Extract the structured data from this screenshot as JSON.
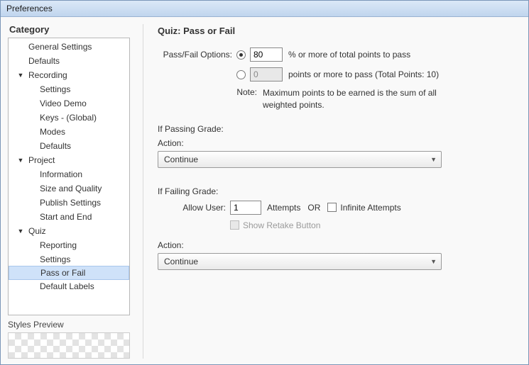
{
  "window": {
    "title": "Preferences"
  },
  "sidebar": {
    "header": "Category",
    "items": [
      {
        "label": "General Settings",
        "level": "level0"
      },
      {
        "label": "Defaults",
        "level": "level0"
      },
      {
        "label": "Recording",
        "level": "has-arrow",
        "arrow": "▼"
      },
      {
        "label": "Settings",
        "level": "level1"
      },
      {
        "label": "Video Demo",
        "level": "level1"
      },
      {
        "label": "Keys - (Global)",
        "level": "level1"
      },
      {
        "label": "Modes",
        "level": "level1"
      },
      {
        "label": "Defaults",
        "level": "level1"
      },
      {
        "label": "Project",
        "level": "has-arrow",
        "arrow": "▼"
      },
      {
        "label": "Information",
        "level": "level1"
      },
      {
        "label": "Size and Quality",
        "level": "level1"
      },
      {
        "label": "Publish Settings",
        "level": "level1"
      },
      {
        "label": "Start and End",
        "level": "level1"
      },
      {
        "label": "Quiz",
        "level": "has-arrow",
        "arrow": "▼"
      },
      {
        "label": "Reporting",
        "level": "level1"
      },
      {
        "label": "Settings",
        "level": "level1"
      },
      {
        "label": "Pass or Fail",
        "level": "level1",
        "selected": true
      },
      {
        "label": "Default Labels",
        "level": "level1"
      }
    ],
    "styles_preview": "Styles Preview"
  },
  "panel": {
    "title": "Quiz: Pass or Fail",
    "pf_options_label": "Pass/Fail Options:",
    "percent_value": "80",
    "percent_suffix": "% or more of total points to pass",
    "points_value": "0",
    "points_suffix": "points or more to pass (Total Points: 10)",
    "note_label": "Note:",
    "note_text": "Maximum points to be earned is the sum of all weighted points.",
    "passing_header": "If Passing Grade:",
    "action_label": "Action:",
    "passing_action": "Continue",
    "failing_header": "If Failing Grade:",
    "allow_user_label": "Allow User:",
    "attempts_value": "1",
    "attempts_suffix": "Attempts",
    "or_text": "OR",
    "infinite_label": "Infinite Attempts",
    "retake_label": "Show Retake Button",
    "failing_action": "Continue"
  }
}
